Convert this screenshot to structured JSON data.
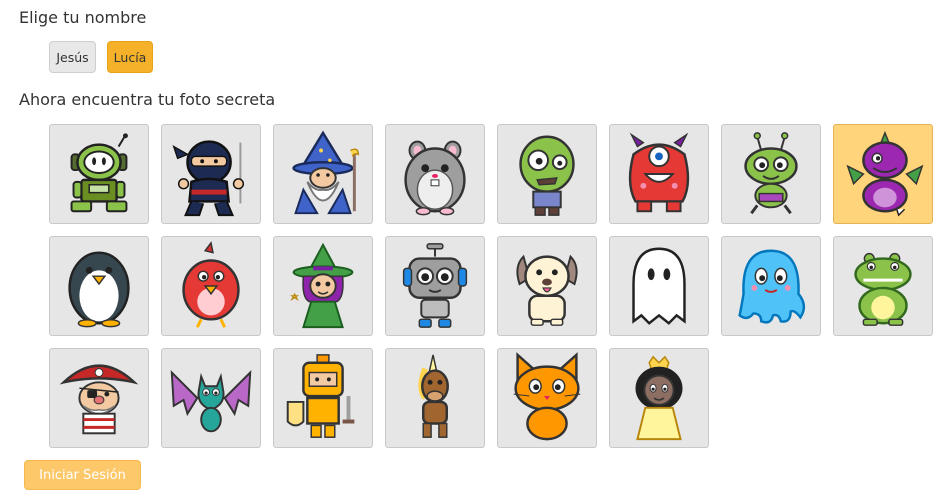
{
  "name_prompt": "Elige tu nombre",
  "names": [
    {
      "label": "Jesús",
      "selected": false
    },
    {
      "label": "Lucía",
      "selected": true
    }
  ],
  "photo_prompt": "Ahora encuentra tu foto secreta",
  "avatars": [
    {
      "icon": "robot-green-icon",
      "selected": false
    },
    {
      "icon": "ninja-icon",
      "selected": false
    },
    {
      "icon": "wizard-icon",
      "selected": false
    },
    {
      "icon": "hamster-icon",
      "selected": false
    },
    {
      "icon": "zombie-icon",
      "selected": false
    },
    {
      "icon": "red-monster-icon",
      "selected": false
    },
    {
      "icon": "alien-icon",
      "selected": false
    },
    {
      "icon": "purple-dragon-icon",
      "selected": true
    },
    {
      "icon": "penguin-icon",
      "selected": false
    },
    {
      "icon": "red-bird-icon",
      "selected": false
    },
    {
      "icon": "witch-girl-icon",
      "selected": false
    },
    {
      "icon": "robot-gray-icon",
      "selected": false
    },
    {
      "icon": "dog-icon",
      "selected": false
    },
    {
      "icon": "ghost-icon",
      "selected": false
    },
    {
      "icon": "blue-octopus-icon",
      "selected": false
    },
    {
      "icon": "green-dragon-icon",
      "selected": false
    },
    {
      "icon": "pirate-icon",
      "selected": false
    },
    {
      "icon": "bat-icon",
      "selected": false
    },
    {
      "icon": "knight-icon",
      "selected": false
    },
    {
      "icon": "unicorn-icon",
      "selected": false
    },
    {
      "icon": "cat-icon",
      "selected": false
    },
    {
      "icon": "princess-icon",
      "selected": false
    }
  ],
  "login_label": "Iniciar Sesión",
  "colors": {
    "accent": "#f5b12a",
    "selected_tile": "#ffd47a",
    "tile": "#e6e6e6",
    "login_disabled": "#fdc869"
  }
}
